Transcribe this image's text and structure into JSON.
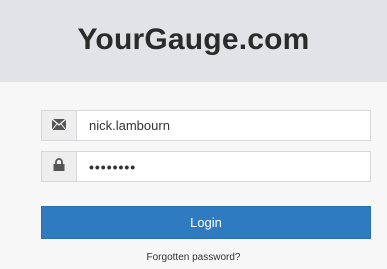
{
  "header": {
    "brand": "YourGauge.com"
  },
  "login_form": {
    "username": {
      "value": "nick.lambourn",
      "icon": "envelope-icon"
    },
    "password": {
      "value": "••••••••",
      "icon": "lock-icon"
    },
    "submit_label": "Login",
    "forgot_label": "Forgotten password?"
  },
  "colors": {
    "header_bg": "#e2e3e6",
    "body_bg": "#f7f7f8",
    "button_bg": "#2f7bbf",
    "icon": "#555555"
  }
}
